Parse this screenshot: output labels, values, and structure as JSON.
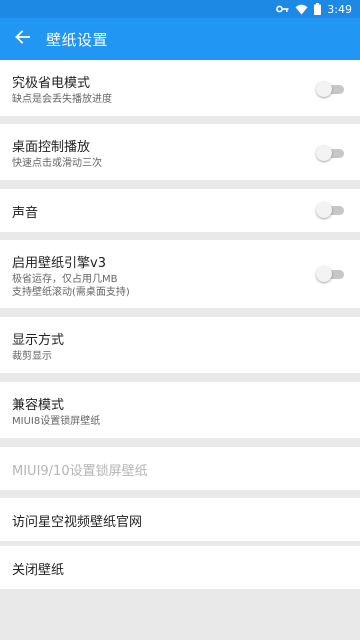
{
  "status_bar": {
    "time": "3:49",
    "icons": [
      "key-icon",
      "wifi-icon",
      "battery-icon"
    ]
  },
  "app_bar": {
    "title": "壁纸设置",
    "back_icon": "arrow-left-icon",
    "background_color": "#2196f3"
  },
  "settings": [
    {
      "title": "究极省电模式",
      "subtitle": "缺点是会丢失播放进度",
      "toggle": false
    },
    {
      "title": "桌面控制播放",
      "subtitle": "快速点击或滑动三次",
      "toggle": false
    },
    {
      "title": "声音",
      "toggle": false
    },
    {
      "title": "启用壁纸引擎v3",
      "subtitle_line1": "极省运存，仅占用几MB",
      "subtitle_line2": "支持壁纸滚动(需桌面支持)",
      "toggle": false
    },
    {
      "title": "显示方式",
      "subtitle": "裁剪显示"
    },
    {
      "title": "兼容模式",
      "subtitle": "MIUI8设置锁屏壁纸"
    },
    {
      "title": "MIUI9/10设置锁屏壁纸",
      "disabled": true
    },
    {
      "title": "访问星空视频壁纸官网"
    },
    {
      "title": "关闭壁纸"
    }
  ]
}
